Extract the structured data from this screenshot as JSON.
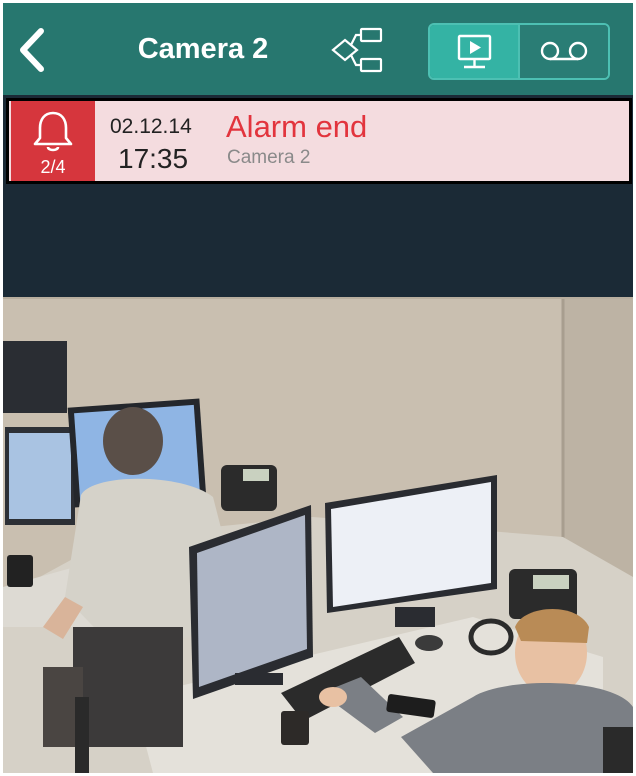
{
  "header": {
    "title": "Camera 2",
    "back_icon": "chevron-left-icon",
    "layout_icon": "hierarchy-icon",
    "mode_toggle": {
      "live_icon": "monitor-play-icon",
      "archive_icon": "voicemail-tape-icon",
      "selected": "live"
    }
  },
  "alarm": {
    "icon": "bell-icon",
    "count": "2/4",
    "date": "02.12.14",
    "time": "17:35",
    "title": "Alarm end",
    "camera": "Camera 2"
  },
  "video": {
    "description_icon": "camera-feed"
  },
  "colors": {
    "header_bg": "#27776f",
    "toggle_active": "#34b3a4",
    "alarm_red": "#d6363d",
    "alarm_bg": "#f4dcdf",
    "alarm_title": "#e2343d",
    "dark_bg": "#1b2a36"
  }
}
